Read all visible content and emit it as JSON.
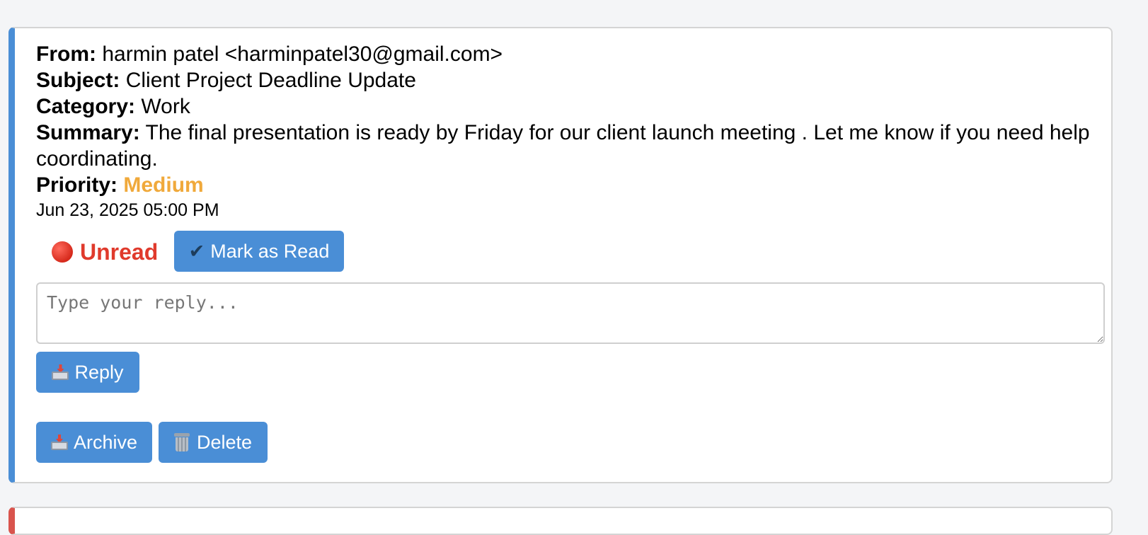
{
  "email": {
    "from_label": "From:",
    "from_value": "harmin patel <harminpatel30@gmail.com>",
    "subject_label": "Subject:",
    "subject_value": "Client Project Deadline Update",
    "category_label": "Category:",
    "category_value": "Work",
    "summary_label": "Summary:",
    "summary_value": "The final presentation is ready by Friday for our client launch meeting . Let me know if you need help coordinating.",
    "priority_label": "Priority:",
    "priority_value": "Medium",
    "timestamp": "Jun 23, 2025 05:00 PM",
    "status": "Unread"
  },
  "actions": {
    "mark_read": "Mark as Read",
    "mark_read_icon": "✔",
    "reply_placeholder": "Type your reply...",
    "reply": "Reply",
    "archive": "Archive",
    "delete": "Delete"
  },
  "colors": {
    "accent": "#4a8ed6",
    "priority_medium": "#f0a93b",
    "unread": "#e03a2c",
    "next_card_border": "#d9544d"
  },
  "icons": {
    "status": "red-circle-icon",
    "reply": "outbox-tray-icon",
    "archive": "outbox-tray-icon",
    "delete": "wastebasket-icon"
  }
}
